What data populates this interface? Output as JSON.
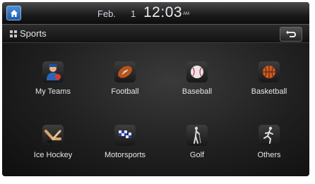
{
  "status": {
    "date": "Feb.",
    "day": "1",
    "time": "12:03",
    "ampm": "AM"
  },
  "header": {
    "title": "Sports"
  },
  "tiles": [
    {
      "label": "My Teams",
      "icon": "my-teams-icon"
    },
    {
      "label": "Football",
      "icon": "football-icon"
    },
    {
      "label": "Baseball",
      "icon": "baseball-icon"
    },
    {
      "label": "Basketball",
      "icon": "basketball-icon"
    },
    {
      "label": "Ice Hockey",
      "icon": "ice-hockey-icon"
    },
    {
      "label": "Motorsports",
      "icon": "motorsports-icon"
    },
    {
      "label": "Golf",
      "icon": "golf-icon"
    },
    {
      "label": "Others",
      "icon": "others-icon"
    }
  ],
  "colors": {
    "home_button": "#2a6fc0",
    "background": "#1f1f1f",
    "text": "#e6e6e6"
  }
}
